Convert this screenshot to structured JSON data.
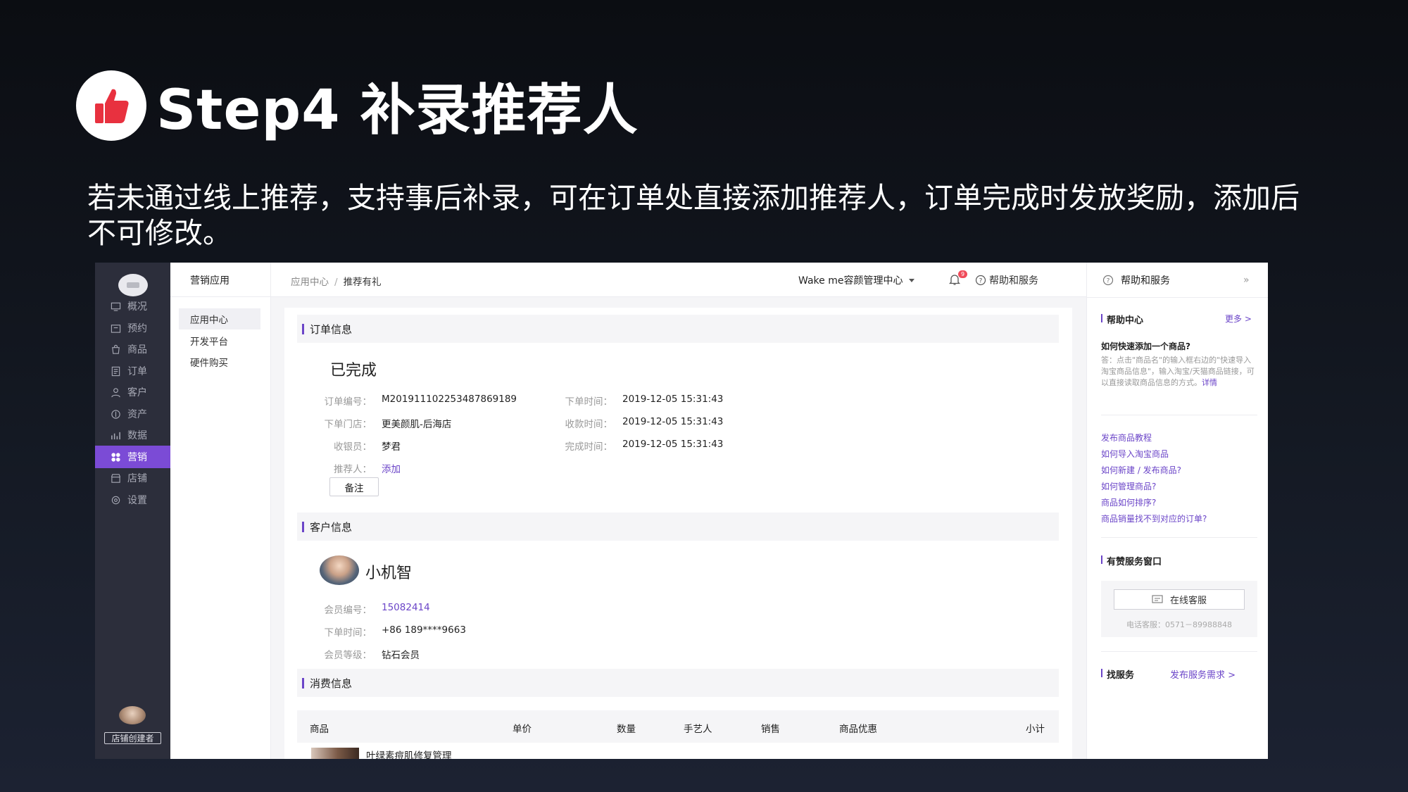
{
  "slide": {
    "title": "Step4 补录推荐人",
    "description": "若未通过线上推荐，支持事后补录，可在订单处直接添加推荐人，订单完成时发放奖励，添加后不可修改。"
  },
  "sidenav": {
    "items": [
      {
        "label": "概况",
        "icon": "monitor-icon"
      },
      {
        "label": "预约",
        "icon": "calendar-icon"
      },
      {
        "label": "商品",
        "icon": "bag-icon"
      },
      {
        "label": "订单",
        "icon": "list-icon"
      },
      {
        "label": "客户",
        "icon": "user-icon"
      },
      {
        "label": "资产",
        "icon": "coin-icon"
      },
      {
        "label": "数据",
        "icon": "bar-chart-icon"
      },
      {
        "label": "营销",
        "icon": "grid-icon",
        "active": true
      },
      {
        "label": "店铺",
        "icon": "store-icon"
      },
      {
        "label": "设置",
        "icon": "settings-icon"
      }
    ],
    "creator_tag": "店铺创建者"
  },
  "subnav": {
    "title": "营销应用",
    "items": [
      "应用中心",
      "开发平台",
      "硬件购买"
    ]
  },
  "topbar": {
    "breadcrumb_parent": "应用中心",
    "breadcrumb_sep": "/",
    "breadcrumb_current": "推荐有礼",
    "store_name": "Wake me容颜管理中心",
    "notification_count": "9",
    "help_label": "帮助和服务"
  },
  "order": {
    "section_title": "订单信息",
    "status": "已完成",
    "order_no_label": "订单编号：",
    "order_no": "M201911102253487869189",
    "store_label": "下单门店：",
    "store": "更美颜肌-后海店",
    "cashier_label": "收银员：",
    "cashier": "梦君",
    "referrer_label": "推荐人：",
    "referrer_action": "添加",
    "order_time_label": "下单时间：",
    "order_time": "2019-12-05 15:31:43",
    "pay_time_label": "收款时间：",
    "pay_time": "2019-12-05 15:31:43",
    "finish_time_label": "完成时间：",
    "finish_time": "2019-12-05 15:31:43",
    "note_button": "备注"
  },
  "customer": {
    "section_title": "客户信息",
    "name": "小机智",
    "member_no_label": "会员编号：",
    "member_no": "15082414",
    "time_label": "下单时间：",
    "phone": "+86 189****9663",
    "level_label": "会员等级：",
    "level": "钻石会员"
  },
  "consumption": {
    "section_title": "消费信息",
    "columns": [
      "商品",
      "单价",
      "数量",
      "手艺人",
      "销售",
      "商品优惠",
      "小计"
    ],
    "first_row_product": "叶绿素痘肌修复管理"
  },
  "help_panel": {
    "title": "帮助和服务",
    "center_title": "帮助中心",
    "more": "更多 >",
    "question": "如何快速添加一个商品?",
    "answer": "答：点击\"商品名\"的输入框右边的\"快速导入淘宝商品信息\"，输入淘宝/天猫商品链接，可以直接读取商品信息的方式。",
    "answer_link": "详情",
    "links": [
      "发布商品教程",
      "如何导入淘宝商品",
      "如何新建 / 发布商品?",
      "如何管理商品?",
      "商品如何排序?",
      "商品销量找不到对应的订单?"
    ],
    "service_title": "有赞服务窗口",
    "online_service": "在线客服",
    "phone": "电话客服：0571－89988848",
    "find_service_title": "找服务",
    "find_service_link": "发布服务需求 >"
  }
}
